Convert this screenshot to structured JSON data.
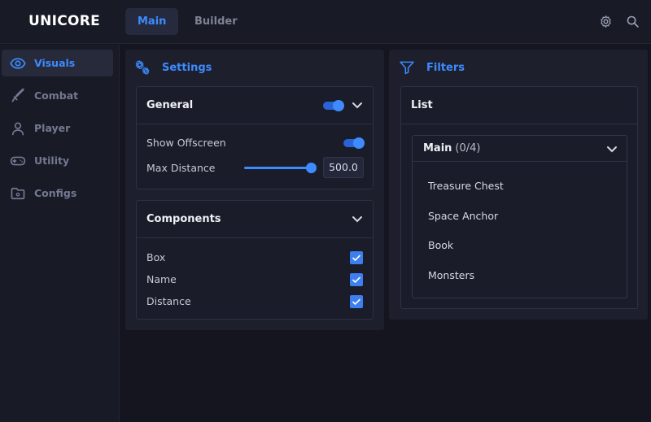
{
  "app": {
    "title": "UNICORE"
  },
  "top_tabs": [
    {
      "label": "Main",
      "active": true
    },
    {
      "label": "Builder",
      "active": false
    }
  ],
  "top_icons": [
    "gear-icon",
    "search-icon"
  ],
  "sidebar": {
    "items": [
      {
        "label": "Visuals",
        "icon": "eye-icon",
        "active": true
      },
      {
        "label": "Combat",
        "icon": "sword-icon",
        "active": false
      },
      {
        "label": "Player",
        "icon": "user-icon",
        "active": false
      },
      {
        "label": "Utility",
        "icon": "gamepad-icon",
        "active": false
      },
      {
        "label": "Configs",
        "icon": "folder-icon",
        "active": false
      }
    ]
  },
  "settings_panel": {
    "title": "Settings",
    "icon": "gears-icon",
    "general": {
      "title": "General",
      "enabled": true,
      "show_offscreen_label": "Show Offscreen",
      "show_offscreen_enabled": true,
      "max_distance_label": "Max Distance",
      "max_distance_value": "500.0",
      "max_distance_fill": 1.0
    },
    "components": {
      "title": "Components",
      "items": [
        {
          "label": "Box",
          "checked": true
        },
        {
          "label": "Name",
          "checked": true
        },
        {
          "label": "Distance",
          "checked": true
        }
      ]
    }
  },
  "filters_panel": {
    "title": "Filters",
    "icon": "filter-icon",
    "list": {
      "title": "List",
      "dropdown": {
        "label": "Main",
        "count": "(0/4)",
        "options": [
          "Treasure Chest",
          "Space Anchor",
          "Book",
          "Monsters"
        ]
      }
    }
  },
  "colors": {
    "accent": "#3d8bff",
    "background": "#14151f",
    "panel": "#1d1f2d"
  }
}
